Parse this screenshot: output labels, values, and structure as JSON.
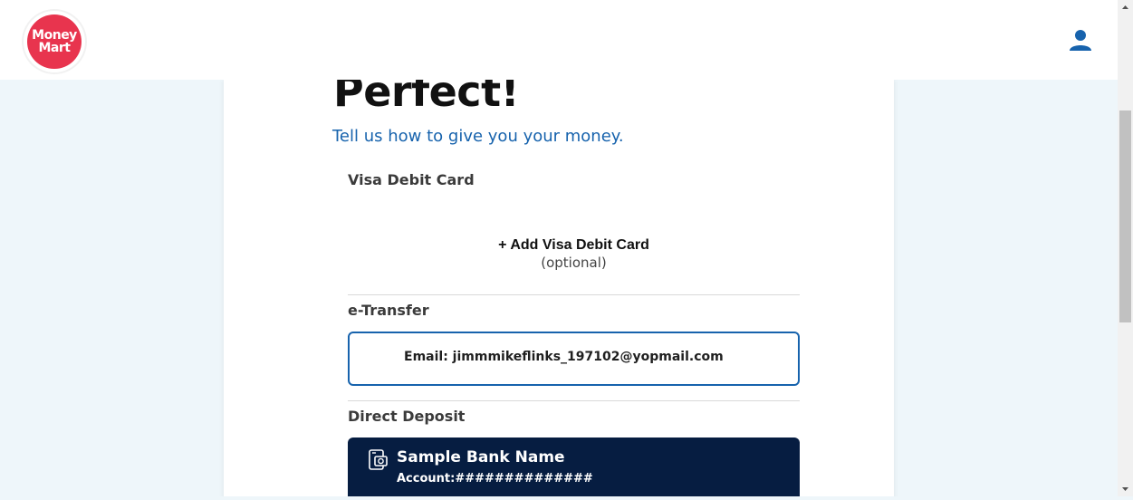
{
  "header": {
    "logo_line1": "Money",
    "logo_line2": "Mart",
    "brand_color": "#e8344e",
    "user_icon": "user-icon"
  },
  "page": {
    "title": "Perfect!",
    "subtitle": "Tell us how to give you your money."
  },
  "visa": {
    "section_label": "Visa Debit Card",
    "add_label": "+ Add Visa Debit Card",
    "add_sub": "(optional)"
  },
  "etransfer": {
    "section_label": "e-Transfer",
    "email_text": "Email: jimmmikeflinks_197102@yopmail.com",
    "border_color": "#1763ad"
  },
  "direct_deposit": {
    "section_label": "Direct Deposit",
    "bank_name": "Sample Bank Name",
    "account_text": "Account:##############",
    "card_color": "#061d41",
    "icon": "bank-cheque-icon"
  }
}
